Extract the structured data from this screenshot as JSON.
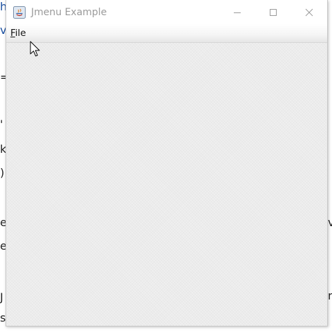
{
  "window": {
    "title": "Jmenu Example",
    "app_icon": "java-icon",
    "controls": {
      "minimize_icon": "minimize-icon",
      "maximize_icon": "maximize-icon",
      "close_icon": "close-icon"
    }
  },
  "menubar": {
    "items": [
      {
        "label_mnemonic": "F",
        "label_rest": "ile"
      }
    ]
  },
  "background_fragments": {
    "top_left_1": "h",
    "top_left_2": "v",
    "left_equals": "=",
    "left_dot": "'",
    "left_k": "k",
    "left_paren": ")",
    "left_er1": "er",
    "left_er2": "er",
    "left_j": "J",
    "left_s": "s",
    "right_v": "v",
    "right_n": "n"
  },
  "colors": {
    "title_text": "#9a9a9a",
    "content_bg": "#ececec",
    "menubar_bg": "#f4f4f4"
  }
}
